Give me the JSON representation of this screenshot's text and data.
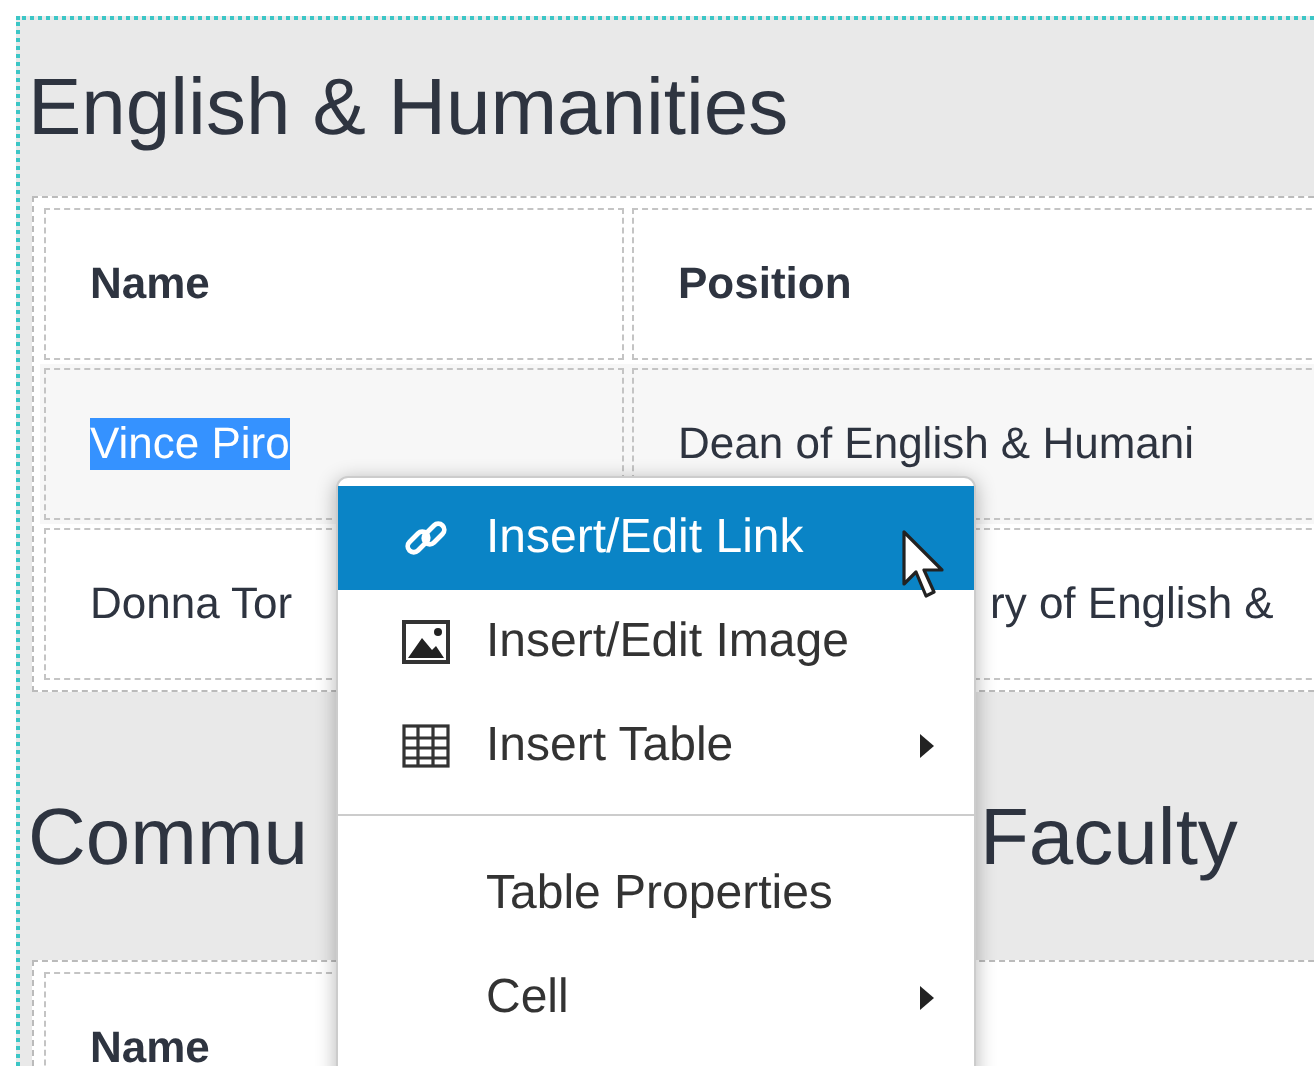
{
  "sections": [
    {
      "heading_parts": [
        "English & Humanities"
      ],
      "table": {
        "columns": [
          "Name",
          "Position"
        ],
        "rows": [
          [
            {
              "text": "Vince Piro",
              "highlighted": true
            },
            {
              "text": "Dean of English & Humani",
              "highlighted": false
            }
          ],
          [
            {
              "text": "Donna Tor",
              "highlighted": false
            },
            {
              "text": "ry of English &",
              "highlighted": false
            }
          ]
        ]
      }
    },
    {
      "heading_parts": [
        "Commu",
        "Faculty"
      ],
      "table": {
        "columns": [
          "Name"
        ]
      }
    }
  ],
  "context_menu": {
    "items": [
      {
        "kind": "link",
        "label": "Insert/Edit Link",
        "selected": true,
        "submenu": false
      },
      {
        "kind": "image",
        "label": "Insert/Edit Image",
        "selected": false,
        "submenu": false
      },
      {
        "kind": "table",
        "label": "Insert Table",
        "selected": false,
        "submenu": true
      },
      {
        "kind": "separator"
      },
      {
        "kind": "text",
        "label": "Table Properties",
        "selected": false,
        "submenu": false
      },
      {
        "kind": "text",
        "label": "Cell",
        "selected": false,
        "submenu": true
      }
    ]
  }
}
